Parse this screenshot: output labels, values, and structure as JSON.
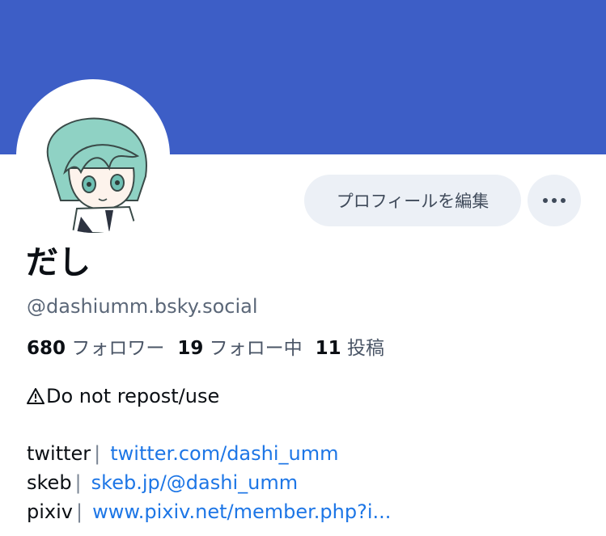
{
  "banner": {
    "color": "#3d5ec6"
  },
  "profile": {
    "display_name": "だし",
    "handle": "@dashiumm.bsky.social",
    "avatar": "chibi-character-avatar"
  },
  "actions": {
    "edit_profile_label": "プロフィールを編集",
    "more_icon": "more-horizontal-icon"
  },
  "stats": {
    "followers_count": "680",
    "followers_label": "フォロワー",
    "following_count": "19",
    "following_label": "フォロー中",
    "posts_count": "11",
    "posts_label": "投稿"
  },
  "bio": {
    "warning_text": "Do not repost/use",
    "links": [
      {
        "site": "twitter",
        "separator": "|",
        "url": "twitter.com/dashi_umm"
      },
      {
        "site": "skeb",
        "separator": "|",
        "url": "skeb.jp/@dashi_umm"
      },
      {
        "site": "pixiv",
        "separator": "|",
        "url": "www.pixiv.net/member.php?i..."
      }
    ]
  },
  "colors": {
    "link": "#1d76e6",
    "button_bg": "#ecf0f6",
    "muted_text": "#5b6778"
  }
}
